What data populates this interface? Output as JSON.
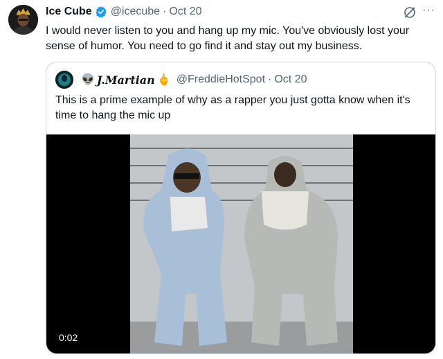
{
  "tweet": {
    "author_name": "Ice Cube",
    "handle": "@icecube",
    "separator": "·",
    "date": "Oct 20",
    "more_label": "···",
    "text": "I would never listen to you and hang up my mic. You've obviously lost your sense of humor. You need to go find it and stay out my business."
  },
  "quote": {
    "author_name": "J.Martian",
    "name_prefix_emoji": "👽",
    "name_suffix_emoji": "🖕",
    "handle": "@FreddieHotSpot",
    "separator": "·",
    "date": "Oct 20",
    "text": "This is a prime example of why as a rapper you just gotta know when it's time to hang the mic up",
    "video": {
      "timestamp": "0:02"
    }
  },
  "colors": {
    "verified": "#1d9bf0",
    "secondary_text": "#536471",
    "border": "#cfd9de"
  },
  "icons": [
    "verified-badge-icon",
    "grok-icon",
    "more-icon"
  ]
}
